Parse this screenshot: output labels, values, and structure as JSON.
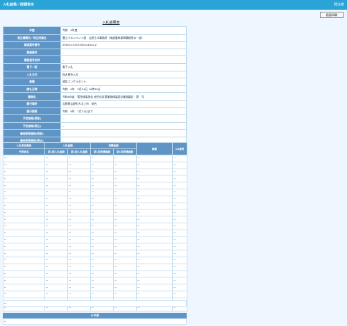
{
  "topbar": {
    "title": "入札結果／詳細表示",
    "page_name": "発注者"
  },
  "print_button": "画面印刷",
  "heading": "入札結果表",
  "info_rows": [
    {
      "label": "年度",
      "value": "令和　6年度"
    },
    {
      "label": "発注機関名／発注所属名",
      "value": "農立マネジメント部　吉野土木事務所（南部農林振興事務所の一部）"
    },
    {
      "label": "調達案件番号",
      "value": "2900101305302024002２"
    },
    {
      "label": "業務番号",
      "value": "--"
    },
    {
      "label": "業務番号名称",
      "value": "--"
    },
    {
      "label": "電子／紙",
      "value": "電子入札"
    },
    {
      "label": "入札方式",
      "value": "指名競争入札"
    },
    {
      "label": "業種",
      "value": "建設コンサルタント"
    },
    {
      "label": "開札日時",
      "value": "令和　6年　5月24日 10時30分"
    },
    {
      "label": "業務名",
      "value": "令和6年度　緊急橋梁強化 老朽化対策業務橋梁設計業務委託　第　号"
    },
    {
      "label": "履行場所",
      "value": "吉野郡吉野町大字上市　地内"
    },
    {
      "label": "履行期限",
      "value": "令和　6年　7月21日まで"
    },
    {
      "label": "予定価格(税抜)",
      "value": "--"
    },
    {
      "label": "予定価格(税込)",
      "value": "--"
    },
    {
      "label": "最低制限価格(税抜)",
      "value": "--"
    },
    {
      "label": "最低制限価格(税込)",
      "value": "--"
    },
    {
      "label": "備考",
      "value": "--"
    }
  ],
  "bid_table": {
    "group_headers": [
      "入札参加業者",
      "入札金額",
      "見積金額",
      "摘要",
      "CD番号"
    ],
    "sub_headers": [
      "代表者名",
      "第1回入札金額",
      "第1回入札金額",
      "第1回見積金額",
      "第1回見積金額"
    ],
    "rows": [
      [
        "--",
        "--",
        "--",
        "--",
        "--",
        "--",
        "--"
      ],
      [
        "--",
        "--",
        "--",
        "--",
        "--",
        "--",
        "--"
      ],
      [
        "--",
        "--",
        "--",
        "--",
        "--",
        "--",
        "--"
      ],
      [
        "--",
        "--",
        "--",
        "--",
        "--",
        "--",
        "--"
      ],
      [
        "--",
        "--",
        "--",
        "--",
        "--",
        "--",
        "--"
      ],
      [
        "--",
        "--",
        "--",
        "--",
        "--",
        "--",
        "--"
      ],
      [
        "--",
        "--",
        "--",
        "--",
        "--",
        "--",
        "--"
      ],
      [
        "--",
        "--",
        "--",
        "--",
        "--",
        "--",
        "--"
      ],
      [
        "--",
        "--",
        "--",
        "--",
        "--",
        "--",
        "--"
      ],
      [
        "--",
        "--",
        "--",
        "--",
        "--",
        "--",
        "--"
      ],
      [
        "--",
        "--",
        "--",
        "--",
        "--",
        "--",
        "--"
      ],
      [
        "--",
        "--",
        "--",
        "--",
        "--",
        "--",
        "--"
      ],
      [
        "--",
        "--",
        "--",
        "--",
        "--",
        "--",
        "--"
      ],
      [
        "--",
        "--",
        "--",
        "--",
        "--",
        "--",
        "--"
      ],
      [
        "--",
        "--",
        "--",
        "--",
        "--",
        "--",
        "--"
      ],
      [
        "--",
        "--",
        "--",
        "--",
        "--",
        "--",
        "--"
      ],
      [
        "--",
        "--",
        "--",
        "--",
        "--",
        "--",
        "--"
      ],
      [
        "--",
        "--",
        "--",
        "--",
        "--",
        "--",
        "--"
      ],
      [
        "--",
        "--",
        "--",
        "--",
        "--",
        "--",
        "--"
      ],
      [
        "--",
        "--",
        "--",
        "--",
        "--",
        "--",
        "--"
      ],
      [
        "--",
        "--",
        "--",
        "--",
        "--",
        "--",
        "--"
      ],
      [
        "--",
        "--",
        "--",
        "--",
        "--",
        "--",
        "--"
      ],
      [
        "--",
        "--",
        "--",
        "--",
        "--",
        "--",
        "--"
      ]
    ],
    "extra_row": "--"
  },
  "other": {
    "title": "その他",
    "value": "--"
  }
}
